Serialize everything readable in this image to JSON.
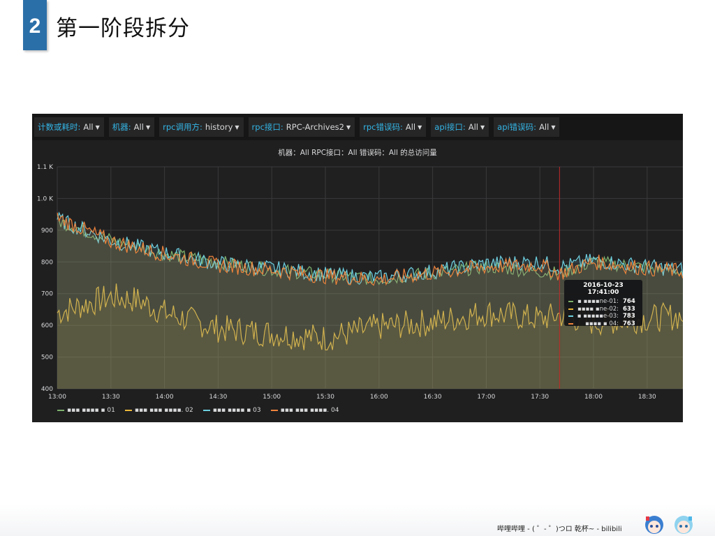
{
  "slide": {
    "number": "2",
    "title": "第一阶段拆分"
  },
  "variables": [
    {
      "label": "计数或耗时:",
      "value": "All"
    },
    {
      "label": "机器:",
      "value": "All"
    },
    {
      "label": "rpc调用方:",
      "value": "history"
    },
    {
      "label": "rpc接口:",
      "value": "RPC-Archives2"
    },
    {
      "label": "rpc错误码:",
      "value": "All"
    },
    {
      "label": "api接口:",
      "value": "All"
    },
    {
      "label": "api错误码:",
      "value": "All"
    }
  ],
  "tooltip": {
    "time": "2016-10-23 17:41:00",
    "rows": [
      {
        "name": "▪ ▪▪▪▪ne-01:",
        "value": "764",
        "color": "#7eb26d"
      },
      {
        "name": "▪▪▪▪ ▪ne-02:",
        "value": "633",
        "color": "#eab839"
      },
      {
        "name": "▪ ▪▪▪▪▪e-03:",
        "value": "783",
        "color": "#6ed0e0"
      },
      {
        "name": "▪▪▪▪ ▪ 04:",
        "value": "763",
        "color": "#ef843c"
      }
    ]
  },
  "footer": {
    "text": "哔哩哔哩 - ( ゜- ゜)つロ 乾杯~ - bilibili"
  },
  "chart_data": {
    "type": "area",
    "title": "机器：All RPC接口：All 错误码：All 的总访问量",
    "x_start": "13:00",
    "x_end": "18:50",
    "x_ticks": [
      "13:00",
      "13:30",
      "14:00",
      "14:30",
      "15:00",
      "15:30",
      "16:00",
      "16:30",
      "17:00",
      "17:30",
      "18:00",
      "18:30"
    ],
    "y_ticks": [
      "400",
      "500",
      "600",
      "700",
      "800",
      "900",
      "1.0 K",
      "1.1 K"
    ],
    "ylim": [
      400,
      1100
    ],
    "cursor_time": "17:41",
    "grid": true,
    "legend_position": "bottom-left",
    "series": [
      {
        "name": "▪▪▪ ▪▪▪▪ ▪ 01",
        "color": "#7eb26d",
        "points": [
          [
            "13:00",
            930
          ],
          [
            "13:30",
            870
          ],
          [
            "14:00",
            825
          ],
          [
            "15:00",
            775
          ],
          [
            "16:00",
            745
          ],
          [
            "17:00",
            785
          ],
          [
            "17:41",
            764
          ],
          [
            "18:00",
            800
          ],
          [
            "18:50",
            770
          ]
        ]
      },
      {
        "name": "▪▪▪ ▪▪▪ ▪▪▪▪. 02",
        "color": "#eab839",
        "points": [
          [
            "13:00",
            640
          ],
          [
            "13:30",
            690
          ],
          [
            "13:45",
            680
          ],
          [
            "14:00",
            640
          ],
          [
            "14:30",
            590
          ],
          [
            "15:00",
            575
          ],
          [
            "15:30",
            560
          ],
          [
            "16:00",
            595
          ],
          [
            "16:30",
            610
          ],
          [
            "17:00",
            640
          ],
          [
            "17:30",
            620
          ],
          [
            "17:41",
            633
          ],
          [
            "18:00",
            610
          ],
          [
            "18:50",
            630
          ]
        ]
      },
      {
        "name": "▪▪▪ ▪▪▪▪ ▪ 03",
        "color": "#6ed0e0",
        "points": [
          [
            "13:00",
            935
          ],
          [
            "13:30",
            868
          ],
          [
            "14:00",
            828
          ],
          [
            "14:30",
            795
          ],
          [
            "15:00",
            780
          ],
          [
            "15:30",
            760
          ],
          [
            "16:00",
            750
          ],
          [
            "16:30",
            770
          ],
          [
            "17:00",
            795
          ],
          [
            "17:30",
            800
          ],
          [
            "17:41",
            783
          ],
          [
            "18:00",
            805
          ],
          [
            "18:30",
            785
          ],
          [
            "18:50",
            775
          ]
        ]
      },
      {
        "name": "▪▪▪ ▪▪▪ ▪▪▪▪. 04",
        "color": "#ef843c",
        "points": [
          [
            "13:00",
            940
          ],
          [
            "13:30",
            865
          ],
          [
            "14:00",
            825
          ],
          [
            "14:30",
            790
          ],
          [
            "15:00",
            775
          ],
          [
            "15:30",
            755
          ],
          [
            "16:00",
            745
          ],
          [
            "16:30",
            765
          ],
          [
            "17:00",
            785
          ],
          [
            "17:30",
            790
          ],
          [
            "17:41",
            763
          ],
          [
            "18:00",
            800
          ],
          [
            "18:30",
            780
          ],
          [
            "18:50",
            770
          ]
        ]
      }
    ]
  }
}
